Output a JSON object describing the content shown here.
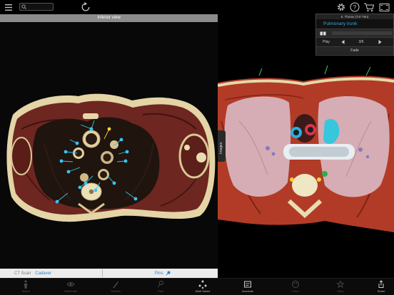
{
  "header": {
    "search": {
      "value": "",
      "placeholder": ""
    }
  },
  "left_panel": {
    "title": "Inferior view",
    "footer": {
      "mode_label": "CT Scan",
      "mode_value": "Cadaver",
      "pins_label": "Pins"
    }
  },
  "images_tab": {
    "label": "Images"
  },
  "selection": {
    "caption": "5. Thorax (T4/ T5n)",
    "structure": "Pulmonary trunk",
    "play_label": "Play",
    "pager": "3/5",
    "fade_label": "Fade"
  },
  "toolbar": {
    "items": [
      {
        "label": "Select",
        "icon": "person-icon",
        "active": false
      },
      {
        "label": "Hide/Fade",
        "icon": "eye-icon",
        "active": false
      },
      {
        "label": "Dissect",
        "icon": "scalpel-icon",
        "active": false
      },
      {
        "label": "Pins",
        "icon": "pin-icon",
        "active": false
      },
      {
        "label": "Multi Select",
        "icon": "multi-select-icon",
        "active": true
      },
      {
        "label": "Annotate",
        "icon": "annotate-icon",
        "active": true
      },
      {
        "label": "Color",
        "icon": "palette-icon",
        "active": false
      },
      {
        "label": "Save",
        "icon": "save-icon",
        "active": false
      },
      {
        "label": "Share",
        "icon": "share-icon",
        "active": true
      }
    ]
  },
  "colors": {
    "accent_blue": "#2f80c7",
    "pin_cyan": "#35c6f0",
    "pin_yellow": "#f0d23a",
    "header_gray": "#8b8b8b"
  }
}
